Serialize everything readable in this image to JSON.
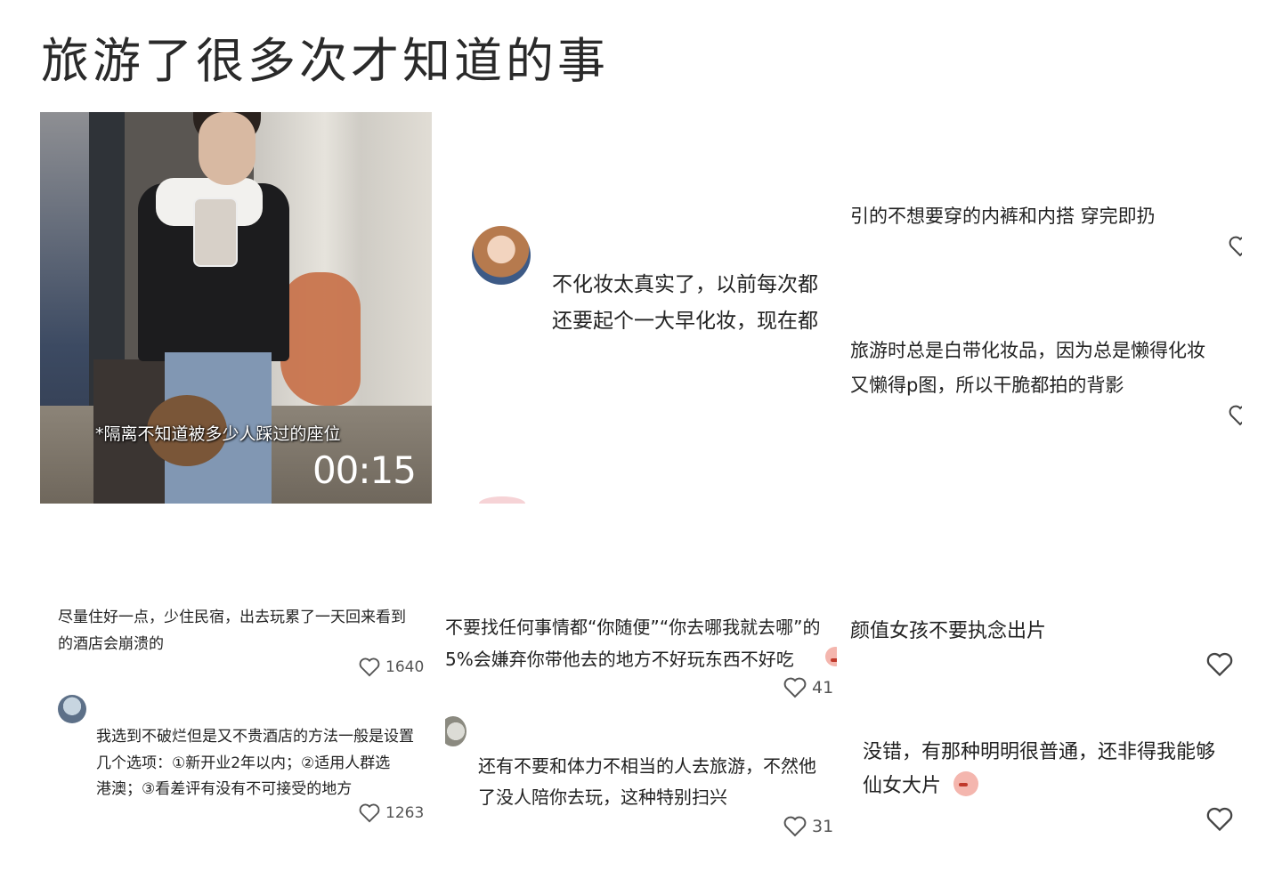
{
  "title": "旅游了很多次才知道的事",
  "video": {
    "caption": "*隔离不知道被多少人踩过的座位",
    "timestamp": "00:15"
  },
  "panel_makeup": {
    "line1": "不化妆太真实了，以前每次都",
    "line2": "还要起个一大早化妆，现在都"
  },
  "panel_underwear": {
    "line1": "引的不想要穿的内裤和内搭 穿完即扔",
    "line2": "旅游时总是白带化妆品，因为总是懒得化妆",
    "line3": "又懒得p图，所以干脆都拍的背影"
  },
  "panel_hotel": {
    "comment1": {
      "line1": "尽量住好一点，少住民宿，出去玩累了一天回来看到",
      "line2": "的酒店会崩溃的",
      "likes": "1640"
    },
    "comment2": {
      "line1": "我选到不破烂但是又不贵酒店的方法一般是设置",
      "line2": "几个选项：①新开业2年以内；②适用人群选",
      "line3": "港澳；③看差评有没有不可接受的地方",
      "likes": "1263"
    }
  },
  "panel_companion": {
    "comment1": {
      "line1": "不要找任何事情都“你随便”“你去哪我就去哪”的",
      "line2": "5%会嫌弃你带他去的地方不好玩东西不好吃",
      "likes": "41"
    },
    "comment2": {
      "line1": "还有不要和体力不相当的人去旅游，不然他",
      "line2": "了没人陪你去玩，这种特别扫兴",
      "likes": "31"
    }
  },
  "panel_photos": {
    "comment1": {
      "line1": "颜值女孩不要执念出片"
    },
    "comment2": {
      "line1": "没错，有那种明明很普通，还非得我能够",
      "line2": "仙女大片"
    }
  },
  "colors": {
    "background": "#ffffff",
    "text": "#222222",
    "muted": "#555555"
  }
}
